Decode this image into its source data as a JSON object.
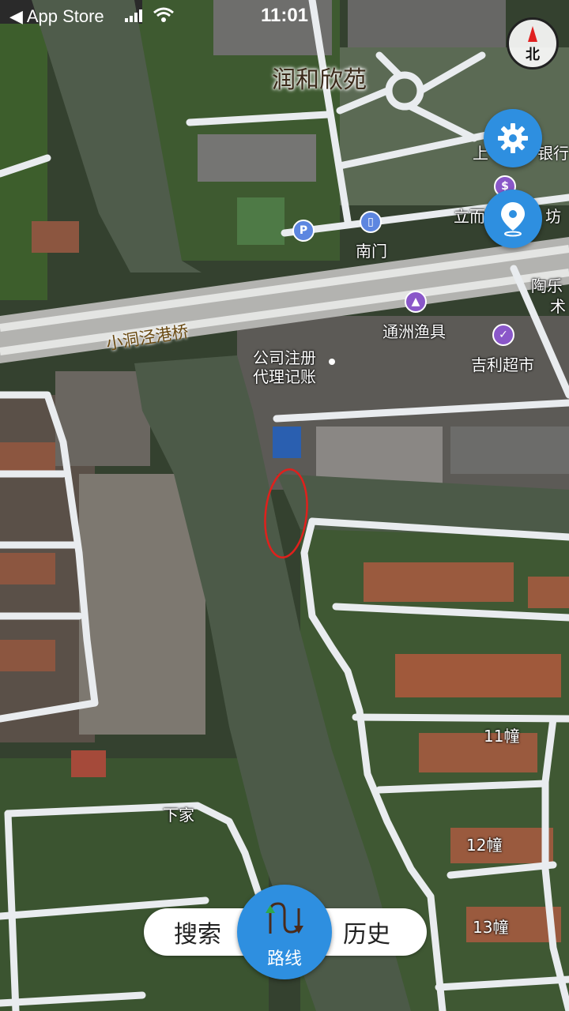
{
  "status_bar": {
    "back_label": "◀ App Store",
    "time": "11:01"
  },
  "map": {
    "labels": {
      "runhe": "润和欣苑",
      "nanmen": "南门",
      "bridge": "小洞泾港桥",
      "tongzhou": "通洲渔具",
      "jili": "吉利超市",
      "company_1": "公司注册",
      "company_2": "代理记账",
      "xiajia": "下家",
      "b11": "11幢",
      "b12": "12幢",
      "b13": "13幢",
      "bank_partial": "上",
      "bank_partial2": "银行",
      "limian": "立而",
      "limian2": "坊",
      "taole": "陶乐",
      "taole2": "术",
      "parking": "P"
    }
  },
  "controls": {
    "compass_label": "北",
    "settings_icon": "gear-icon",
    "location_icon": "location-pin-icon"
  },
  "bottom_nav": {
    "search": "搜索",
    "route": "路线",
    "history": "历史"
  },
  "colors": {
    "accent": "#2e8fe0",
    "poi_purple": "#8a57c9",
    "water": "#4c5a48",
    "road": "#e9ecef"
  }
}
